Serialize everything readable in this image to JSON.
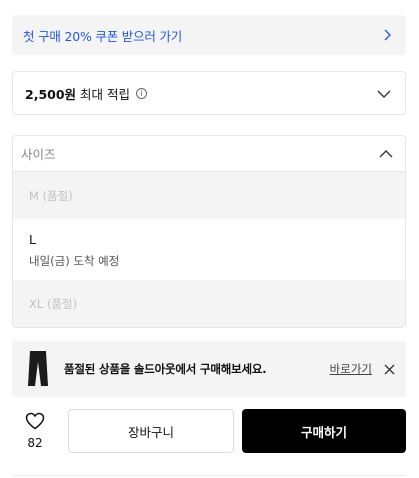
{
  "coupon": {
    "text": "첫 구매 20% 쿠폰 받으러 가기",
    "color": "#1f5ae6"
  },
  "points": {
    "amount": "2,500원",
    "label": "최대 적립"
  },
  "size_select": {
    "placeholder": "사이즈",
    "options": [
      {
        "name": "M (품절)"
      },
      {
        "name": "L",
        "delivery": "내일(금) 도착 예정"
      },
      {
        "name": "XL (품절)"
      }
    ]
  },
  "soldout_banner": {
    "message": "품절된 상품을 솔드아웃에서 구매해보세요.",
    "link": "바로가기"
  },
  "actions": {
    "like_count": "82",
    "cart_label": "장바구니",
    "buy_label": "구매하기"
  }
}
